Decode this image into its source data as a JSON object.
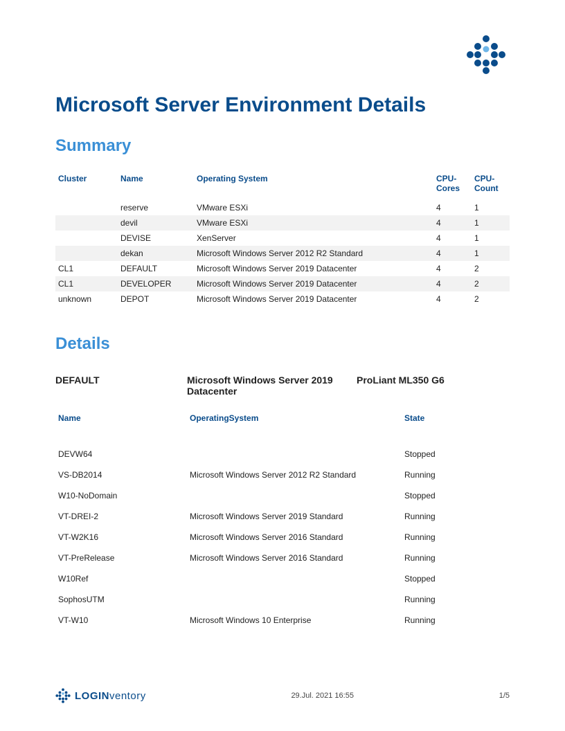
{
  "title": "Microsoft Server Environment Details",
  "sections": {
    "summary": "Summary",
    "details": "Details"
  },
  "summary_table": {
    "headers": {
      "cluster": "Cluster",
      "name": "Name",
      "os": "Operating System",
      "cpu_cores": "CPU-Cores",
      "cpu_count": "CPU-Count"
    },
    "rows": [
      {
        "cluster": "",
        "name": "reserve",
        "os": "VMware ESXi",
        "cores": "4",
        "count": "1"
      },
      {
        "cluster": "",
        "name": "devil",
        "os": "VMware ESXi",
        "cores": "4",
        "count": "1"
      },
      {
        "cluster": "",
        "name": "DEVISE",
        "os": "XenServer",
        "cores": "4",
        "count": "1"
      },
      {
        "cluster": "",
        "name": "dekan",
        "os": "Microsoft Windows Server 2012 R2 Standard",
        "cores": "4",
        "count": "1"
      },
      {
        "cluster": "CL1",
        "name": "DEFAULT",
        "os": "Microsoft Windows Server 2019 Datacenter",
        "cores": "4",
        "count": "2"
      },
      {
        "cluster": "CL1",
        "name": "DEVELOPER",
        "os": "Microsoft Windows Server 2019 Datacenter",
        "cores": "4",
        "count": "2"
      },
      {
        "cluster": "unknown",
        "name": "DEPOT",
        "os": "Microsoft Windows Server 2019 Datacenter",
        "cores": "4",
        "count": "2"
      }
    ]
  },
  "details_header": {
    "host": "DEFAULT",
    "os": "Microsoft Windows Server 2019 Datacenter",
    "model": "ProLiant ML350 G6"
  },
  "details_table": {
    "headers": {
      "name": "Name",
      "os": "OperatingSystem",
      "state": "State"
    },
    "rows": [
      {
        "name": "DEVW64",
        "os": "",
        "state": "Stopped"
      },
      {
        "name": "VS-DB2014",
        "os": "Microsoft Windows Server 2012 R2 Standard",
        "state": "Running"
      },
      {
        "name": "W10-NoDomain",
        "os": "",
        "state": "Stopped"
      },
      {
        "name": "VT-DREI-2",
        "os": "Microsoft Windows Server 2019 Standard",
        "state": "Running"
      },
      {
        "name": "VT-W2K16",
        "os": "Microsoft Windows Server 2016 Standard",
        "state": "Running"
      },
      {
        "name": "VT-PreRelease",
        "os": "Microsoft Windows Server 2016 Standard",
        "state": "Running"
      },
      {
        "name": "W10Ref",
        "os": "",
        "state": "Stopped"
      },
      {
        "name": "SophosUTM",
        "os": "",
        "state": "Running"
      },
      {
        "name": "VT-W10",
        "os": "Microsoft Windows 10 Enterprise",
        "state": "Running"
      }
    ]
  },
  "footer": {
    "brand1": "LOGIN",
    "brand2": "ventory",
    "timestamp": "29.Jul. 2021 16:55",
    "page": "1/5"
  }
}
